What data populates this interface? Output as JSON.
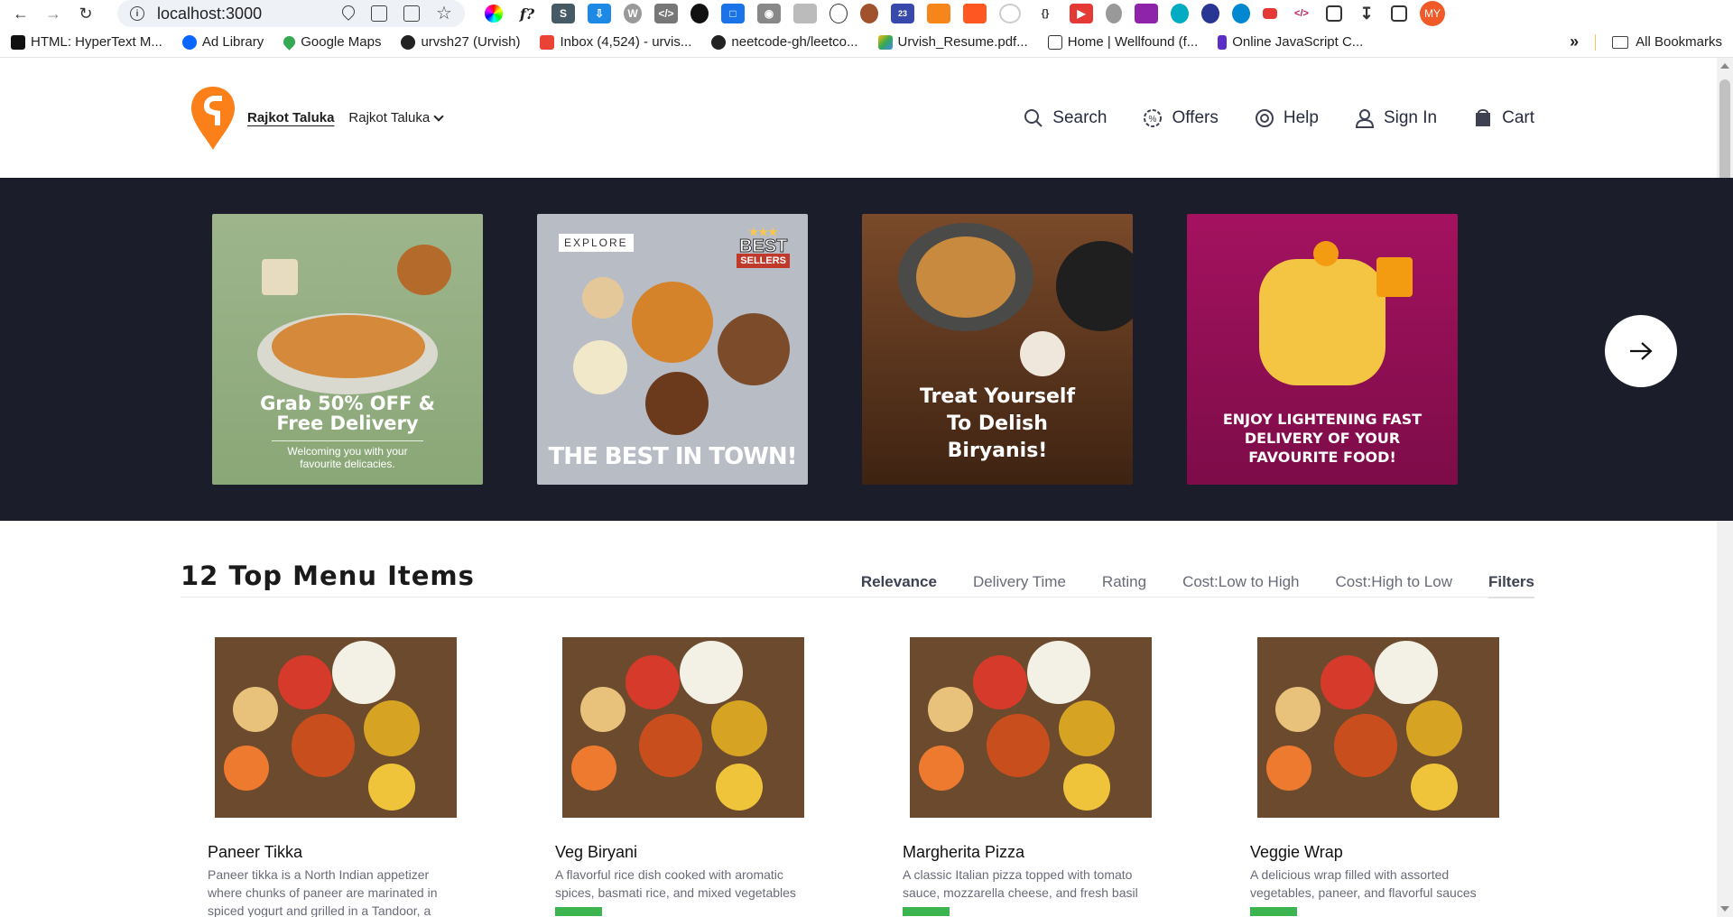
{
  "browser": {
    "url": "localhost:3000",
    "profile_initials": "MY",
    "ext_badge": "23",
    "bookmarks": [
      {
        "label": "HTML: HyperText M...",
        "icon": "mdn-icon"
      },
      {
        "label": "Ad Library",
        "icon": "meta-icon"
      },
      {
        "label": "Google Maps",
        "icon": "maps-icon"
      },
      {
        "label": "urvsh27 (Urvish)",
        "icon": "github-icon"
      },
      {
        "label": "Inbox (4,524) - urvis...",
        "icon": "gmail-icon"
      },
      {
        "label": "neetcode-gh/leetco...",
        "icon": "github-icon"
      },
      {
        "label": "Urvish_Resume.pdf...",
        "icon": "drive-icon"
      },
      {
        "label": "Home | Wellfound (f...",
        "icon": "wellfound-icon"
      },
      {
        "label": "Online JavaScript C...",
        "icon": "programiz-icon"
      }
    ],
    "overflow": "»",
    "all_bookmarks": "All Bookmarks"
  },
  "header": {
    "location_main": "Rajkot Taluka",
    "location_sub": "Rajkot Taluka",
    "nav": [
      {
        "label": "Search",
        "icon": "search-icon"
      },
      {
        "label": "Offers",
        "icon": "offers-icon"
      },
      {
        "label": "Help",
        "icon": "help-icon"
      },
      {
        "label": "Sign In",
        "icon": "user-icon"
      },
      {
        "label": "Cart",
        "icon": "cart-icon"
      }
    ]
  },
  "banners": [
    {
      "title": "Grab 50% OFF & Free Delivery",
      "subtitle": "Welcoming you with your favourite delicacies."
    },
    {
      "tag": "EXPLORE",
      "badge_top": "BEST",
      "badge_bottom": "SELLERS",
      "title": "THE BEST IN TOWN!"
    },
    {
      "title": "Treat Yourself To Delish Biryanis!"
    },
    {
      "title": "ENJOY LIGHTENING FAST DELIVERY OF YOUR FAVOURITE FOOD!"
    }
  ],
  "menu": {
    "title": "12 Top Menu Items",
    "sorts": [
      "Relevance",
      "Delivery Time",
      "Rating",
      "Cost:Low to High",
      "Cost:High to Low",
      "Filters"
    ],
    "items": [
      {
        "name": "Paneer Tikka",
        "description": "Paneer tikka is a North Indian appetizer where chunks of paneer are marinated in spiced yogurt and grilled in a Tandoor, a"
      },
      {
        "name": "Veg Biryani",
        "description": "A flavorful rice dish cooked with aromatic spices, basmati rice, and mixed vegetables"
      },
      {
        "name": "Margherita Pizza",
        "description": "A classic Italian pizza topped with tomato sauce, mozzarella cheese, and fresh basil"
      },
      {
        "name": "Veggie Wrap",
        "description": "A delicious wrap filled with assorted vegetables, paneer, and flavorful sauces"
      }
    ]
  },
  "colors": {
    "brand": "#fc8019",
    "banner_bg": "#1b1d2a",
    "rating_green": "#3cb551"
  }
}
